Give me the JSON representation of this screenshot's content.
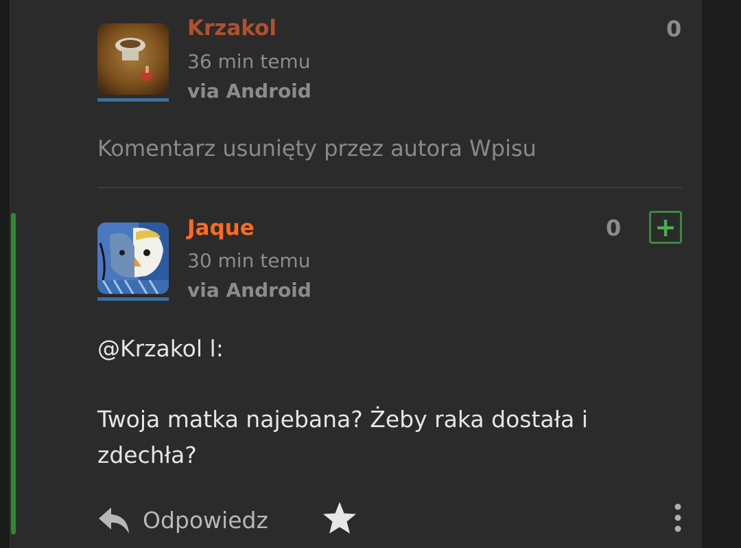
{
  "comments": [
    {
      "username": "Krzakol",
      "username_color": "#b0502e",
      "time": "36 min temu",
      "source": "via Android",
      "score": "0",
      "deleted_text": "Komentarz usunięty przez autora Wpisu"
    },
    {
      "username": "Jaque",
      "username_color": "#ff6a1f",
      "time": "30 min temu",
      "source": "via Android",
      "score": "0",
      "plus_label": "+",
      "body_lines": [
        "@Krzakol l:",
        "Twoja matka najebana? Żeby raka dostała i",
        "zdechła?"
      ],
      "actions": {
        "reply_label": "Odpowiedz",
        "reply_icon": "reply-arrow-icon",
        "favorite_icon": "star-icon",
        "more_icon": "more-vertical-icon"
      }
    }
  ],
  "colors": {
    "panel": "#2b2b2b",
    "accent_green": "#2e8a2e",
    "avatar_underline": "#3a6f9a"
  }
}
